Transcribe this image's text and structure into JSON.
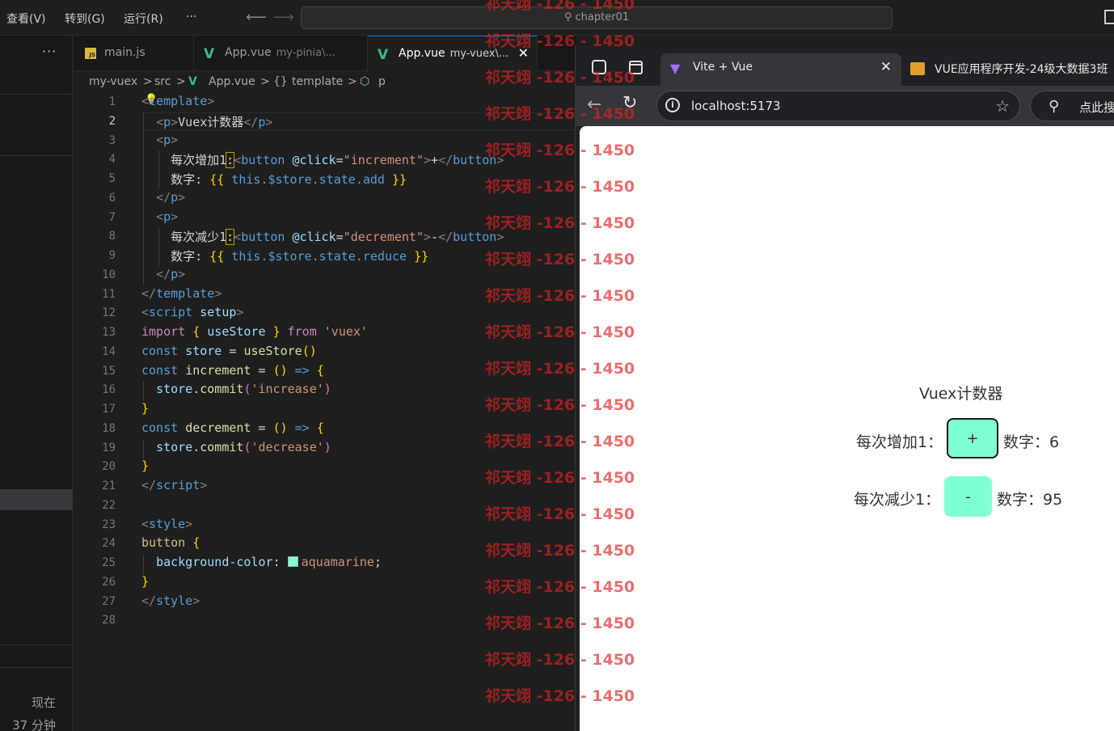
{
  "menu": {
    "items": [
      "查看(V)",
      "转到(G)",
      "运行(R)",
      "···"
    ]
  },
  "command_center": {
    "label": "chapter01"
  },
  "sidepanel": {
    "more": "···",
    "time_label": "现在",
    "time_ago": "37 分钟"
  },
  "tabs": [
    {
      "label": "main.js",
      "sub": ""
    },
    {
      "label": "App.vue",
      "sub": "my-pinia\\..."
    },
    {
      "label": "App.vue",
      "sub": "my-vuex\\...",
      "close": "✕"
    }
  ],
  "breadcrumb": {
    "items": [
      "my-vuex",
      "src",
      "App.vue",
      "template",
      "p"
    ],
    "sep": ">"
  },
  "code": {
    "line_numbers": [
      "1",
      "2",
      "3",
      "4",
      "5",
      "6",
      "7",
      "8",
      "9",
      "10",
      "11",
      "12",
      "13",
      "14",
      "15",
      "16",
      "17",
      "18",
      "19",
      "20",
      "21",
      "22",
      "23",
      "24",
      "25",
      "26",
      "27",
      "28"
    ],
    "template_open": "template",
    "p_text": "Vuex计数器",
    "inc_label": "每次增加1",
    "inc_handler": "increment",
    "inc_symbol": "+",
    "num_label": "数字",
    "add_expr": "this.$store.state.add",
    "dec_label": "每次减少1",
    "dec_handler": "decrement",
    "dec_symbol": "-",
    "reduce_expr": "this.$store.state.reduce",
    "import_name": "useStore",
    "import_src": "'vuex'",
    "store_var": "store",
    "inc_commit": "'increase'",
    "dec_commit": "'decrease'",
    "css_prop": "background-color",
    "css_value": "aquamarine",
    "css_color": "#7fffd4"
  },
  "browser": {
    "tab_active": "Vite + Vue",
    "tab_active_close": "✕",
    "tab_other": "VUE应用程序开发-24级大数据3班",
    "url": "localhost:5173",
    "search_label": "点此搜"
  },
  "app": {
    "title": "Vuex计数器",
    "inc_label": "每次增加1：",
    "inc_button": "+",
    "inc_number_label": "数字：6",
    "dec_label": "每次减少1：",
    "dec_button": "-",
    "dec_number_label": "数字：95",
    "accent": "#7fffd4"
  },
  "watermark": {
    "text": "祁天翊 -126 - 1450"
  }
}
